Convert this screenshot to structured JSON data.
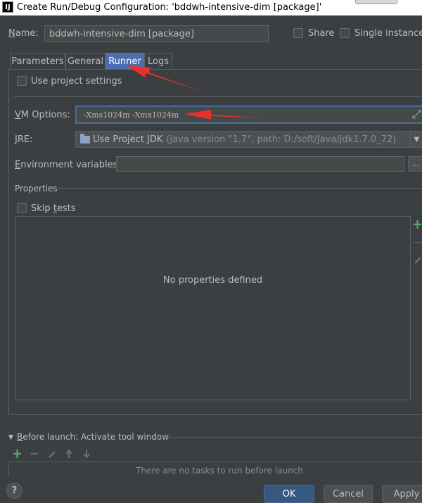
{
  "window": {
    "title": "Create Run/Debug Configuration: 'bddwh-intensive-dim [package]'",
    "app_icon_label": "IJ"
  },
  "header": {
    "name_label": "Name:",
    "name_value": "bddwh-intensive-dim [package]",
    "share_label": "Share",
    "single_instance_label": "Single instance o"
  },
  "tabs": [
    {
      "label": "Parameters",
      "active": false
    },
    {
      "label": "General",
      "active": false
    },
    {
      "label": "Runner",
      "active": true
    },
    {
      "label": "Logs",
      "active": false
    }
  ],
  "runner": {
    "use_project_settings_label": "Use project settings",
    "vm_options_label": "VM Options:",
    "vm_options_value": "-Xms1024m -Xmx1024m",
    "jre_label": "JRE:",
    "jre_value": "Use Project JDK",
    "jre_detail": "(java version \"1.7\", path: D:/soft/Java/jdk1.7.0_72)",
    "env_label": "Environment variables:",
    "env_value": "",
    "env_button": "...",
    "properties_label": "Properties",
    "skip_tests_label": "Skip tests",
    "empty_properties": "No properties defined"
  },
  "before_launch": {
    "label": "Before launch: Activate tool window",
    "empty_text": "There are no tasks to run before launch"
  },
  "buttons": {
    "ok": "OK",
    "cancel": "Cancel",
    "apply": "Apply",
    "help": "?"
  },
  "colors": {
    "background": "#3c3f41",
    "tab_active": "#4b6eaf",
    "add_green": "#59a869",
    "annotation_arrow": "#e8312d",
    "ok_button": "#365880"
  }
}
